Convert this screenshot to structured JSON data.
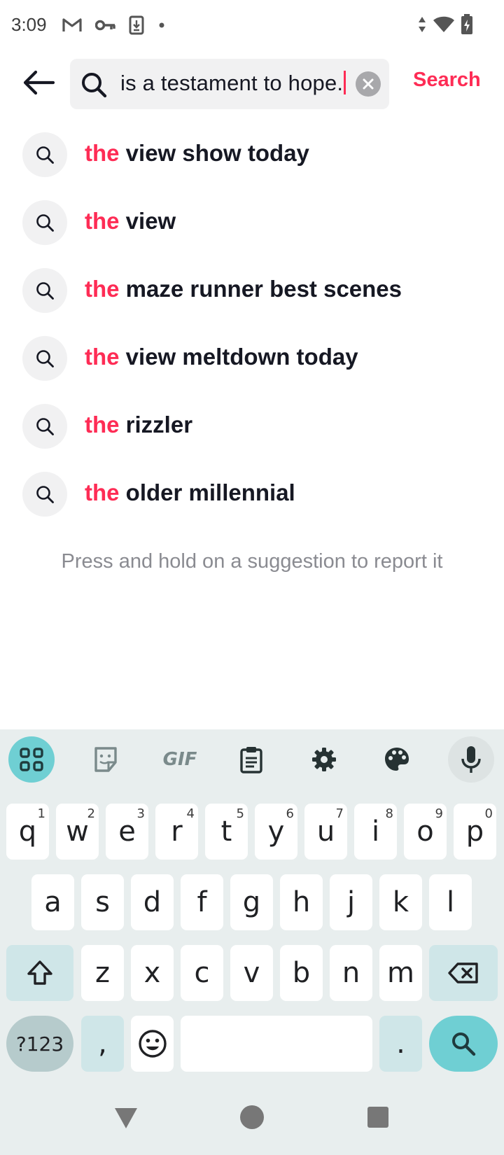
{
  "status_bar": {
    "time": "3:09",
    "left_icons": [
      "gmail-icon",
      "key-icon",
      "download-icon",
      "dot-icon"
    ],
    "right_icons": [
      "data-arrows-icon",
      "wifi-icon",
      "battery-icon"
    ]
  },
  "search": {
    "query": "is a testament to hope.",
    "search_button_label": "Search",
    "accent_color": "#fe2c55"
  },
  "suggestions": [
    {
      "highlight": "the",
      "rest": " view show today"
    },
    {
      "highlight": "the",
      "rest": " view"
    },
    {
      "highlight": "the",
      "rest": " maze runner best scenes"
    },
    {
      "highlight": "the",
      "rest": " view meltdown today"
    },
    {
      "highlight": "the",
      "rest": " rizzler"
    },
    {
      "highlight": "the",
      "rest": " older millennial"
    }
  ],
  "hint": "Press and hold on a suggestion to report it",
  "keyboard": {
    "toolbar": [
      "apps-grid-icon",
      "sticker-icon",
      "gif-icon",
      "clipboard-icon",
      "settings-icon",
      "palette-icon",
      "mic-icon"
    ],
    "gif_label": "GIF",
    "row1": [
      {
        "k": "q",
        "n": "1"
      },
      {
        "k": "w",
        "n": "2"
      },
      {
        "k": "e",
        "n": "3"
      },
      {
        "k": "r",
        "n": "4"
      },
      {
        "k": "t",
        "n": "5"
      },
      {
        "k": "y",
        "n": "6"
      },
      {
        "k": "u",
        "n": "7"
      },
      {
        "k": "i",
        "n": "8"
      },
      {
        "k": "o",
        "n": "9"
      },
      {
        "k": "p",
        "n": "0"
      }
    ],
    "row2": [
      "a",
      "s",
      "d",
      "f",
      "g",
      "h",
      "j",
      "k",
      "l"
    ],
    "row3": [
      "z",
      "x",
      "c",
      "v",
      "b",
      "n",
      "m"
    ],
    "symbols_label": "?123",
    "comma": ",",
    "period": "."
  }
}
